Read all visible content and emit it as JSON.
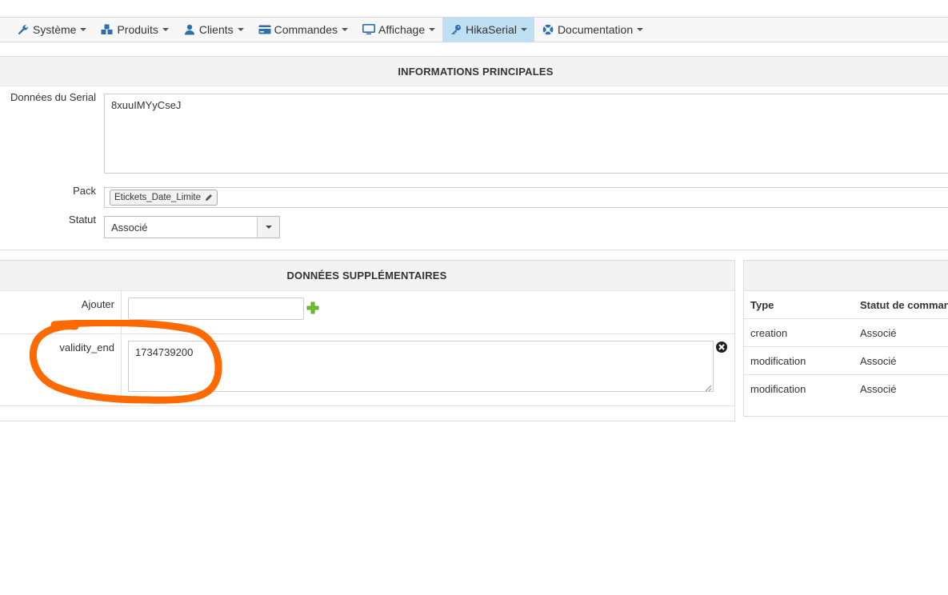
{
  "nav": {
    "items": [
      {
        "label": "Système",
        "icon": "wrench-icon"
      },
      {
        "label": "Produits",
        "icon": "cubes-icon"
      },
      {
        "label": "Clients",
        "icon": "user-icon"
      },
      {
        "label": "Commandes",
        "icon": "credit-card-icon"
      },
      {
        "label": "Affichage",
        "icon": "monitor-icon"
      },
      {
        "label": "HikaSerial",
        "icon": "key-icon",
        "active": true
      },
      {
        "label": "Documentation",
        "icon": "help-circle-icon"
      }
    ]
  },
  "main_info": {
    "title": "INFORMATIONS PRINCIPALES",
    "serial_label": "Données du Serial",
    "serial_value": "8xuuIMYyCseJ",
    "pack_label": "Pack",
    "pack_tag": "Etickets_Date_Limite",
    "status_label": "Statut",
    "status_value": "Associé"
  },
  "extra": {
    "title": "DONNÉES SUPPLÉMENTAIRES",
    "add_label": "Ajouter",
    "add_placeholder": "",
    "validity_label": "validity_end",
    "validity_value": "1734739200"
  },
  "history": {
    "columns": [
      "Type",
      "Statut de comman"
    ],
    "rows": [
      [
        "creation",
        "Associé"
      ],
      [
        "modification",
        "Associé"
      ],
      [
        "modification",
        "Associé"
      ]
    ]
  },
  "colors": {
    "active_nav": "#bfe0f2",
    "annotation": "#ff6a00",
    "add_icon": "#6cbf2a"
  }
}
